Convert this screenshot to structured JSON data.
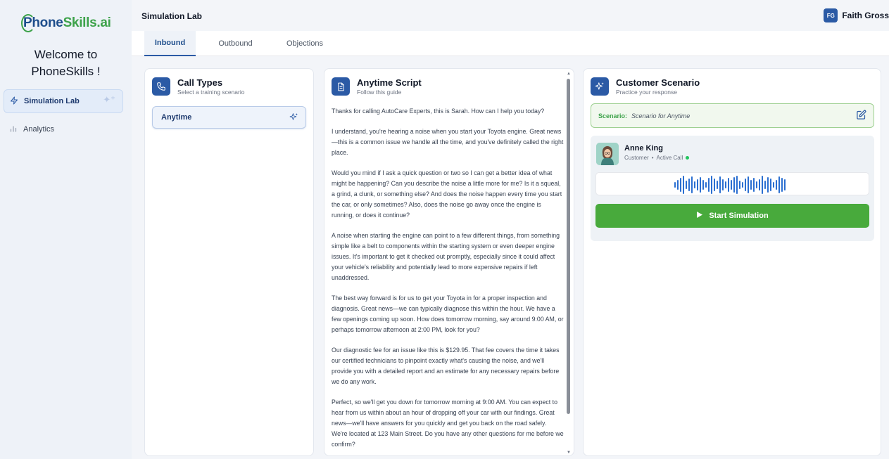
{
  "brand": {
    "logo_part1": "Phone",
    "logo_part2": "Skills.ai"
  },
  "sidebar": {
    "welcome_line1": "Welcome to",
    "welcome_line2": "PhoneSkills !",
    "items": [
      {
        "label": "Simulation Lab",
        "icon": "bolt-icon",
        "active": true
      },
      {
        "label": "Analytics",
        "icon": "bar-chart-icon",
        "active": false
      }
    ]
  },
  "header": {
    "title": "Simulation Lab",
    "user_initials": "FG",
    "user_name": "Faith Gross"
  },
  "tabs": [
    {
      "label": "Inbound",
      "active": true
    },
    {
      "label": "Outbound",
      "active": false
    },
    {
      "label": "Objections",
      "active": false
    }
  ],
  "call_types": {
    "title": "Call Types",
    "subtitle": "Select a training scenario",
    "items": [
      {
        "label": "Anytime",
        "selected": true
      }
    ]
  },
  "script": {
    "title": "Anytime Script",
    "subtitle": "Follow this guide",
    "paragraphs": [
      "Thanks for calling AutoCare Experts, this is Sarah. How can I help you today?",
      "I understand, you're hearing a noise when you start your Toyota engine. Great news—this is a common issue we handle all the time, and you've definitely called the right place.",
      "Would you mind if I ask a quick question or two so I can get a better idea of what might be happening? Can you describe the noise a little more for me? Is it a squeal, a grind, a clunk, or something else? And does the noise happen every time you start the car, or only sometimes? Also, does the noise go away once the engine is running, or does it continue?",
      "A noise when starting the engine can point to a few different things, from something simple like a belt to components within the starting system or even deeper engine issues. It's important to get it checked out promptly, especially since it could affect your vehicle's reliability and potentially lead to more expensive repairs if left unaddressed.",
      "The best way forward is for us to get your Toyota in for a proper inspection and diagnosis. Great news—we can typically diagnose this within the hour. We have a few openings coming up soon. How does tomorrow morning, say around 9:00 AM, or perhaps tomorrow afternoon at 2:00 PM, look for you?",
      "Our diagnostic fee for an issue like this is $129.95. That fee covers the time it takes our certified technicians to pinpoint exactly what's causing the noise, and we'll provide you with a detailed report and an estimate for any necessary repairs before we do any work.",
      "Perfect, so we'll get you down for tomorrow morning at 9:00 AM. You can expect to hear from us within about an hour of dropping off your car with our findings. Great news—we'll have answers for you quickly and get you back on the road safely. We're located at 123 Main Street. Do you have any other questions for me before we confirm?"
    ]
  },
  "scenario": {
    "title": "Customer Scenario",
    "subtitle": "Practice your response",
    "scenario_label": "Scenario:",
    "scenario_value": "Scenario for Anytime",
    "customer_name": "Anne King",
    "customer_role": "Customer",
    "call_status": "Active Call",
    "start_button": "Start Simulation"
  },
  "colors": {
    "accent": "#2b5aa5",
    "brand_green": "#3da24a",
    "start_button": "#48aa3c",
    "status_dot": "#22c55e"
  }
}
